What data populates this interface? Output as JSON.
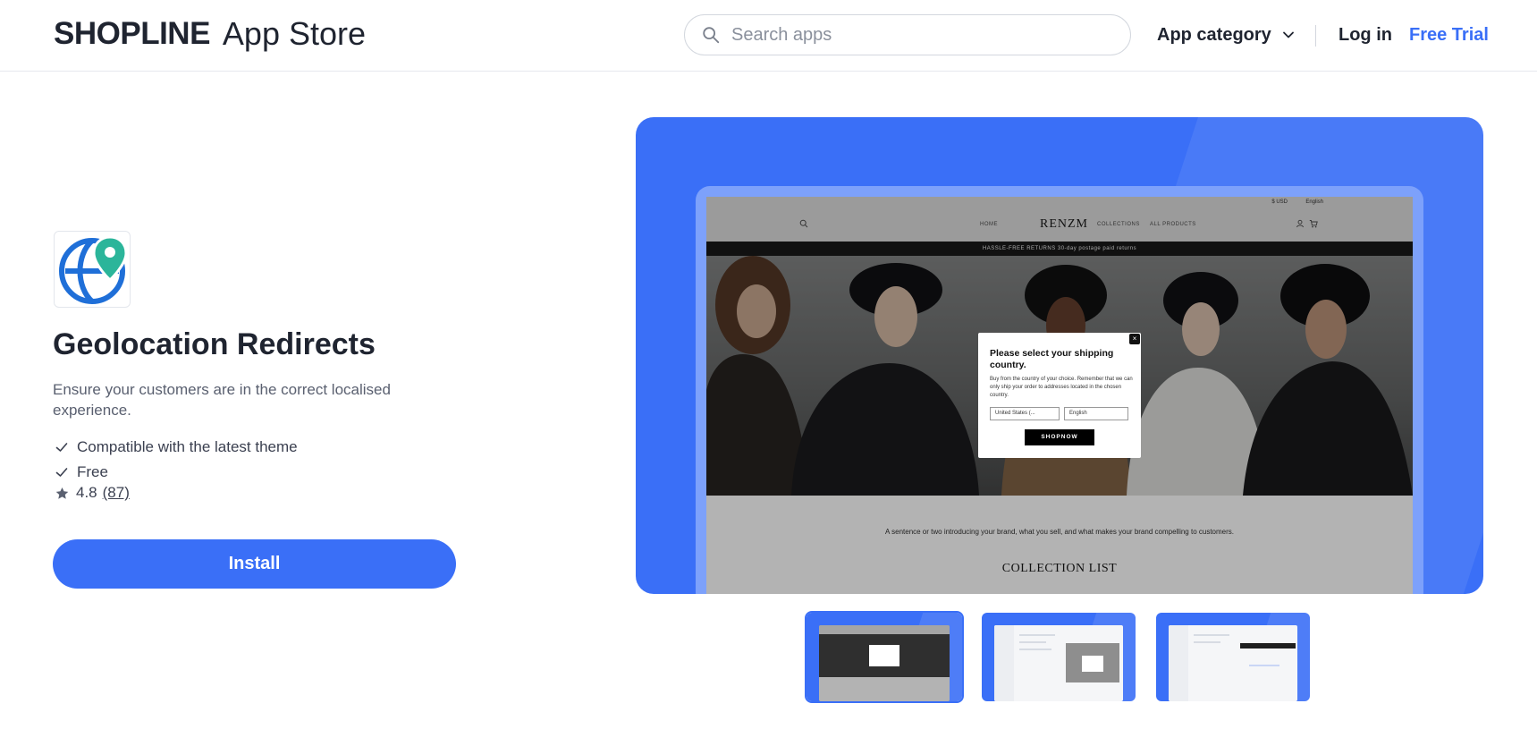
{
  "header": {
    "logo_brand": "SHOPLINE",
    "logo_app": "App Store",
    "search_placeholder": "Search apps",
    "category_label": "App category",
    "login_label": "Log in",
    "trial_label": "Free Trial"
  },
  "app": {
    "title": "Geolocation Redirects",
    "description": "Ensure your customers are in the correct localised experience.",
    "features": [
      "Compatible with the latest theme",
      "Free"
    ],
    "rating": "4.8",
    "reviews": "(87)",
    "install_label": "Install"
  },
  "preview": {
    "store_currency": "$ USD",
    "store_language": "English",
    "store_brand": "RENZM",
    "store_nav": [
      "HOME",
      "COLLECTIONS",
      "ALL PRODUCTS"
    ],
    "promo": "HASSLE-FREE RETURNS   30-day postage paid returns",
    "modal_close": "×",
    "modal_title": "Please select your shipping country.",
    "modal_text": "Buy from the country of your choice. Remember that we can only ship your order to addresses located in the chosen country.",
    "modal_country": "United States   (...",
    "modal_language": "English",
    "modal_button": "SHOPNOW",
    "tagline": "A sentence or two introducing your brand, what you sell, and what makes your brand compelling to customers.",
    "collection_heading": "COLLECTION LIST"
  },
  "thumbnails": [
    "screenshot-1",
    "screenshot-2",
    "screenshot-3"
  ],
  "colors": {
    "accent": "#3a6ff7",
    "text": "#1f2430",
    "muted": "#5a6070"
  }
}
